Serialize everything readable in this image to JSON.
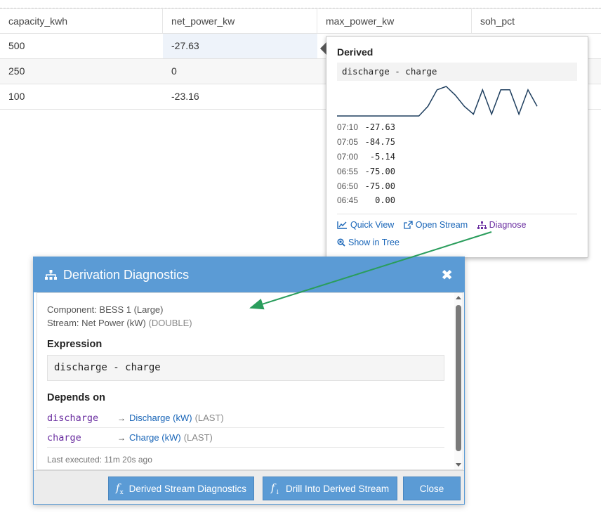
{
  "table": {
    "columns": [
      "capacity_kwh",
      "net_power_kw",
      "max_power_kw",
      "soh_pct"
    ],
    "rows": [
      {
        "capacity_kwh": "500",
        "net_power_kw": "-27.63"
      },
      {
        "capacity_kwh": "250",
        "net_power_kw": "0"
      },
      {
        "capacity_kwh": "100",
        "net_power_kw": "-23.16"
      }
    ]
  },
  "popover": {
    "title": "Derived",
    "expression": "discharge - charge",
    "sparkline_values": [
      0,
      0,
      0,
      0,
      0,
      0,
      0,
      0,
      0,
      0,
      -27.63,
      -75,
      -84.75,
      -60,
      -27.63,
      -5.14,
      -75,
      -5.14,
      -75,
      -75,
      -5.14,
      -75,
      -27.63
    ],
    "values": [
      {
        "time": "07:10",
        "value": "-27.63"
      },
      {
        "time": "07:05",
        "value": "-84.75"
      },
      {
        "time": "07:00",
        "value": "-5.14"
      },
      {
        "time": "06:55",
        "value": "-75.00"
      },
      {
        "time": "06:50",
        "value": "-75.00"
      },
      {
        "time": "06:45",
        "value": "0.00"
      }
    ],
    "links": {
      "quick_view": "Quick View",
      "open_stream": "Open Stream",
      "diagnose": "Diagnose",
      "show_in_tree": "Show in Tree"
    }
  },
  "modal": {
    "title": "Derivation Diagnostics",
    "close": "✖",
    "component_label": "Component: BESS 1 (Large)",
    "stream_label": "Stream: Net Power (kW)",
    "stream_type": "(DOUBLE)",
    "expression_heading": "Expression",
    "expression": "discharge - charge",
    "depends_heading": "Depends on",
    "dependencies": [
      {
        "name": "discharge",
        "arrow": "→",
        "target": "Discharge (kW)",
        "agg": "(LAST)"
      },
      {
        "name": "charge",
        "arrow": "→",
        "target": "Charge (kW)",
        "agg": "(LAST)"
      }
    ],
    "last_executed": "Last executed: 11m 20s ago",
    "buttons": {
      "derived_diag": "Derived Stream Diagnostics",
      "drill": "Drill Into Derived Stream",
      "close": "Close"
    }
  },
  "colors": {
    "accent": "#5b9bd5",
    "link": "#1a66b8",
    "purple": "#6a2ea0",
    "connector": "#2a9d5c",
    "spark": "#1f3f5f"
  }
}
